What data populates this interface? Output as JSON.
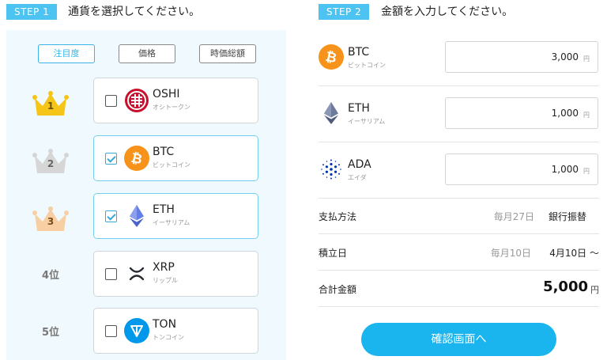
{
  "step1": {
    "badge": "STEP 1",
    "title": "通貨を選択してください。"
  },
  "step2": {
    "badge": "STEP 2",
    "title": "金額を入力してください。"
  },
  "sort": {
    "buttons": [
      {
        "label": "注目度",
        "active": true
      },
      {
        "label": "価格",
        "active": false
      },
      {
        "label": "時価総額",
        "active": false
      }
    ]
  },
  "ranks": [
    {
      "label": "1",
      "crown": "gold-crown-icon",
      "color": "#f5c518"
    },
    {
      "label": "2",
      "crown": "silver-crown-icon",
      "color": "#cfcfcf"
    },
    {
      "label": "3",
      "crown": "bronze-crown-icon",
      "color": "#f6c99a"
    },
    {
      "label": "4位"
    },
    {
      "label": "5位"
    }
  ],
  "coins": [
    {
      "symbol": "OSHI",
      "kana": "オシトークン",
      "checked": false,
      "icon": "oshi-icon",
      "color": "#c8102e"
    },
    {
      "symbol": "BTC",
      "kana": "ビットコイン",
      "checked": true,
      "icon": "bitcoin-icon",
      "color": "#f7931a"
    },
    {
      "symbol": "ETH",
      "kana": "イーサリアム",
      "checked": true,
      "icon": "ethereum-icon",
      "color": "#627eea"
    },
    {
      "symbol": "XRP",
      "kana": "リップル",
      "checked": false,
      "icon": "xrp-icon",
      "color": "#23292f"
    },
    {
      "symbol": "TON",
      "kana": "トンコイン",
      "checked": false,
      "icon": "toncoin-icon",
      "color": "#0098ea"
    }
  ],
  "amounts": [
    {
      "symbol": "BTC",
      "kana": "ビットコイン",
      "value": "3,000",
      "unit": "円",
      "icon": "bitcoin-icon"
    },
    {
      "symbol": "ETH",
      "kana": "イーサリアム",
      "value": "1,000",
      "unit": "円",
      "icon": "ethereum-icon"
    },
    {
      "symbol": "ADA",
      "kana": "エイダ",
      "value": "1,000",
      "unit": "円",
      "icon": "cardano-icon"
    }
  ],
  "payment": {
    "label": "支払方法",
    "sub": "毎月27日",
    "value": "銀行振替"
  },
  "schedule": {
    "label": "積立日",
    "sub": "毎月10日",
    "value": "4月10日 〜"
  },
  "total": {
    "label": "合計金額",
    "value": "5,000",
    "unit": "円"
  },
  "confirm": {
    "label": "確認画面へ"
  },
  "colors": {
    "accent": "#1ab4ee",
    "step_badge": "#4cc3f0",
    "panel_bg": "#f0f9fd"
  }
}
